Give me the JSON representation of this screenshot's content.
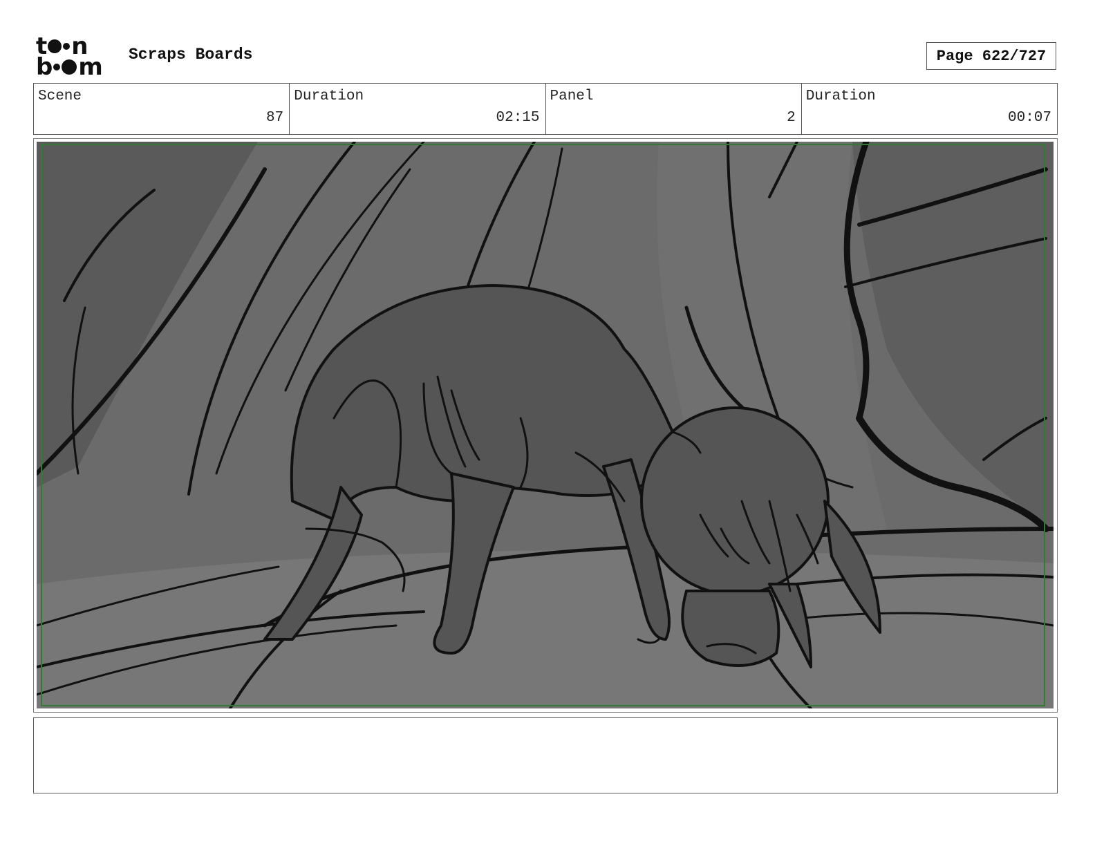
{
  "header": {
    "logo_top": "t  n",
    "logo_bottom": "b  m",
    "title": "Scraps Boards",
    "page_label": "Page 622/727"
  },
  "info": {
    "scene_label": "Scene",
    "scene_value": "87",
    "scene_duration_label": "Duration",
    "scene_duration_value": "02:15",
    "panel_label": "Panel",
    "panel_value": "2",
    "panel_duration_label": "Duration",
    "panel_duration_value": "00:07"
  },
  "notes": {
    "text": ""
  },
  "colors": {
    "safe_frame": "#2e7d32",
    "ink": "#111111",
    "creature_fill": "#555555",
    "background_gray": "#6b6b6b"
  }
}
